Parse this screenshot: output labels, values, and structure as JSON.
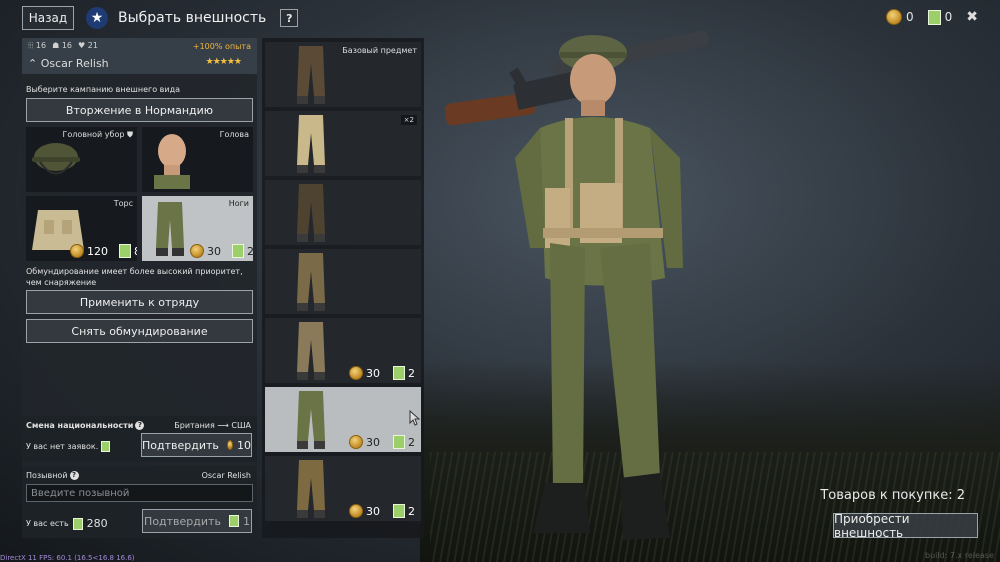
{
  "header": {
    "back_label": "Назад",
    "title": "Выбрать внешность",
    "help_label": "?"
  },
  "currency": {
    "gold": "0",
    "tickets": "0"
  },
  "soldier": {
    "stat1": "16",
    "stat2": "16",
    "stat3": "21",
    "xp_bonus": "+100% опыта",
    "name": "Oscar Relish",
    "stars": "★★★★★"
  },
  "appearance": {
    "campaign_prompt": "Выберите кампанию внешнего вида",
    "campaign_button": "Вторжение в Нормандию",
    "slots": [
      {
        "label": "Головной убор",
        "icon": "shield-icon"
      },
      {
        "label": "Голова"
      },
      {
        "label": "Торс",
        "price_gold": "120",
        "price_tickets": "8"
      },
      {
        "label": "Ноги",
        "price_gold": "30",
        "price_tickets": "2"
      }
    ],
    "priority_note": "Обмундирование имеет более высокий приоритет, чем снаряжение",
    "apply_squad": "Применить к отряду",
    "remove_uniform": "Снять обмундирование"
  },
  "nationality": {
    "title": "Смена национальности",
    "from_to": "Британия ⟶ США",
    "no_requests": "У вас нет заявок.",
    "confirm_label": "Подтвердить",
    "confirm_price": "10"
  },
  "callsign": {
    "title": "Позывной",
    "value": "Oscar Relish",
    "placeholder": "Введите позывной",
    "have_label": "У вас есть",
    "have_amount": "280",
    "confirm_label": "Подтвердить",
    "confirm_price": "1"
  },
  "variants": [
    {
      "label": "Базовый предмет",
      "color": "#5a4a36"
    },
    {
      "count": "×2",
      "color": "#c9b98a"
    },
    {
      "color": "#4e4230"
    },
    {
      "color": "#7a6a48"
    },
    {
      "price_gold": "30",
      "price_tickets": "2",
      "color": "#8a7a5a"
    },
    {
      "price_gold": "30",
      "price_tickets": "2",
      "color": "#6a7446",
      "selected": true
    },
    {
      "price_gold": "30",
      "price_tickets": "2",
      "color": "#7d6a40"
    }
  ],
  "purchase": {
    "count_label": "Товаров к покупке: 2",
    "buy_button": "Приобрести внешность"
  },
  "footer": {
    "debug": "DirectX 11 FPS: 60.1 (16.5<16.8 16.6)",
    "build": "build: 7.x release"
  }
}
